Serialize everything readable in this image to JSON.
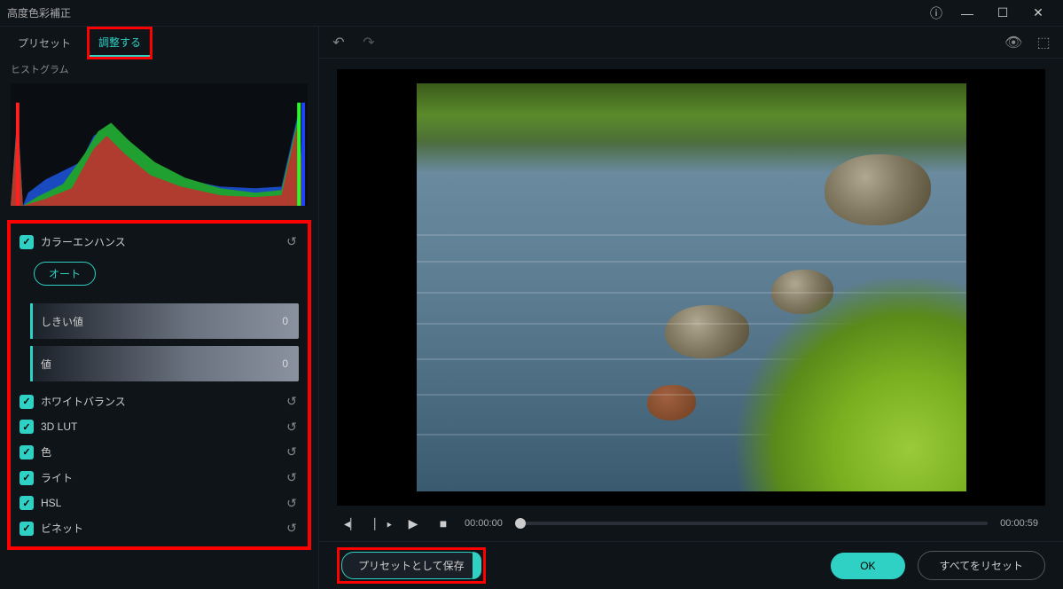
{
  "window": {
    "title": "高度色彩補正"
  },
  "tabs": {
    "preset": "プリセット",
    "adjust": "調整する"
  },
  "histogram": {
    "label": "ヒストグラム"
  },
  "sections": {
    "color_enhance": {
      "label": "カラーエンハンス",
      "auto": "オート",
      "threshold": {
        "label": "しきい値",
        "value": "0"
      },
      "value": {
        "label": "値",
        "value": "0"
      }
    },
    "white_balance": {
      "label": "ホワイトバランス"
    },
    "lut": {
      "label": "3D LUT"
    },
    "color": {
      "label": "色"
    },
    "light": {
      "label": "ライト"
    },
    "hsl": {
      "label": "HSL"
    },
    "vignette": {
      "label": "ビネット"
    }
  },
  "transport": {
    "current": "00:00:00",
    "duration": "00:00:59"
  },
  "footer": {
    "save_preset": "プリセットとして保存",
    "ok": "OK",
    "reset_all": "すべてをリセット"
  }
}
